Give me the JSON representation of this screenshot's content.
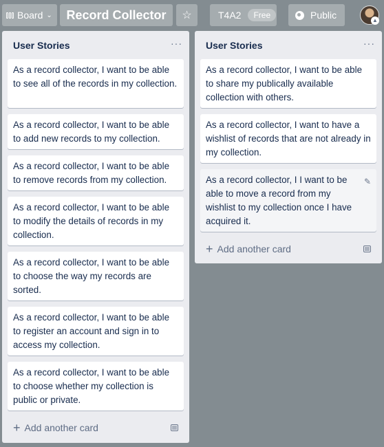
{
  "topbar": {
    "board_label": "Board",
    "board_title": "Record Collector",
    "star_icon": "☆",
    "team_name": "T4A2",
    "team_badge": "Free",
    "visibility_label": "Public"
  },
  "lists": [
    {
      "title": "User Stories",
      "menu_label": "···",
      "cards": [
        "As a record collector, I want to be able to see all of the records in my collection.",
        "As a record collector, I want to be able to add new records to my collection.",
        "As a record collector, I want to be able to remove records from my collection.",
        "As a record collector, I want to be able to modify the details of records in my collection.",
        "As a record collector, I want to be able to choose the way my records are sorted.",
        "As a record collector, I want to be able to register an account and sign in to access my collection.",
        "As a record collector, I want to be able to choose whether my collection is public or private."
      ],
      "add_card_label": "Add another card"
    },
    {
      "title": "User Stories",
      "menu_label": "···",
      "cards": [
        "As a record collector, I want to be able to share my publically available collection with others.",
        "As a record collector, I want to have a wishlist of records that are not already in my collection.",
        "As a record collector, I I want to be able to move a record from my wishlist to my collection once I have acquired it."
      ],
      "add_card_label": "Add another card"
    }
  ],
  "colors": {
    "background": "#838c91",
    "list_background": "#ebecf0",
    "card_text": "#172b4d"
  }
}
